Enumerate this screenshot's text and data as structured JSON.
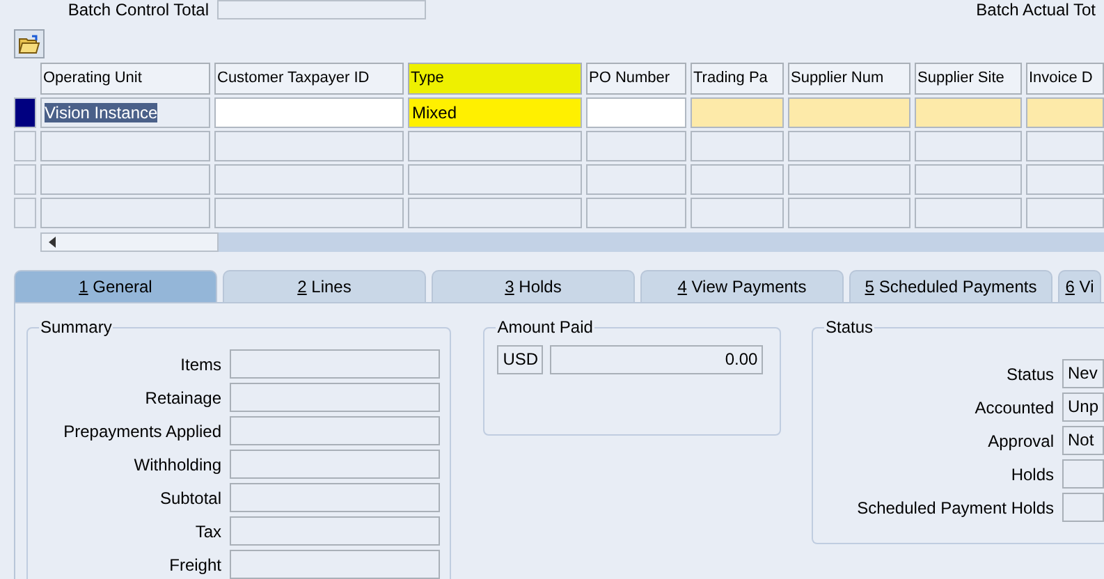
{
  "batch": {
    "control_total_label": "Batch Control Total",
    "actual_total_label": "Batch Actual Tot"
  },
  "table": {
    "columns": [
      {
        "label": "Operating Unit",
        "highlighted": false
      },
      {
        "label": "Customer Taxpayer ID",
        "highlighted": false
      },
      {
        "label": "Type",
        "highlighted": true
      },
      {
        "label": "PO Number",
        "highlighted": false
      },
      {
        "label": "Trading Pa",
        "highlighted": false
      },
      {
        "label": "Supplier Num",
        "highlighted": false
      },
      {
        "label": "Supplier Site",
        "highlighted": false
      },
      {
        "label": "Invoice D",
        "highlighted": false
      }
    ],
    "rows": [
      {
        "current": true,
        "cells": [
          {
            "kind": "selected",
            "value": "Vision Instance"
          },
          {
            "kind": "editable"
          },
          {
            "kind": "editable",
            "value": "Mixed"
          },
          {
            "kind": "editable"
          },
          {
            "kind": "required"
          },
          {
            "kind": "required"
          },
          {
            "kind": "required"
          },
          {
            "kind": "required"
          }
        ]
      },
      {
        "current": false
      },
      {
        "current": false
      },
      {
        "current": false
      }
    ]
  },
  "tabs": [
    {
      "number": "1",
      "label": "General",
      "selected": true
    },
    {
      "number": "2",
      "label": "Lines",
      "selected": false
    },
    {
      "number": "3",
      "label": "Holds",
      "selected": false
    },
    {
      "number": "4",
      "label": "View Payments",
      "selected": false
    },
    {
      "number": "5",
      "label": "Scheduled Payments",
      "selected": false
    },
    {
      "number": "6",
      "label": "Vi",
      "selected": false
    }
  ],
  "summary": {
    "title": "Summary",
    "fields": [
      {
        "label": "Items"
      },
      {
        "label": "Retainage"
      },
      {
        "label": "Prepayments Applied"
      },
      {
        "label": "Withholding"
      },
      {
        "label": "Subtotal"
      },
      {
        "label": "Tax"
      },
      {
        "label": "Freight"
      }
    ]
  },
  "amount_paid": {
    "title": "Amount Paid",
    "currency": "USD",
    "value": "0.00"
  },
  "status": {
    "title": "Status",
    "fields": [
      {
        "label": "Status",
        "value": "Nev"
      },
      {
        "label": "Accounted",
        "value": "Unp"
      },
      {
        "label": "Approval",
        "value": "Not"
      },
      {
        "label": "Holds"
      },
      {
        "label": "Scheduled Payment Holds"
      }
    ]
  }
}
